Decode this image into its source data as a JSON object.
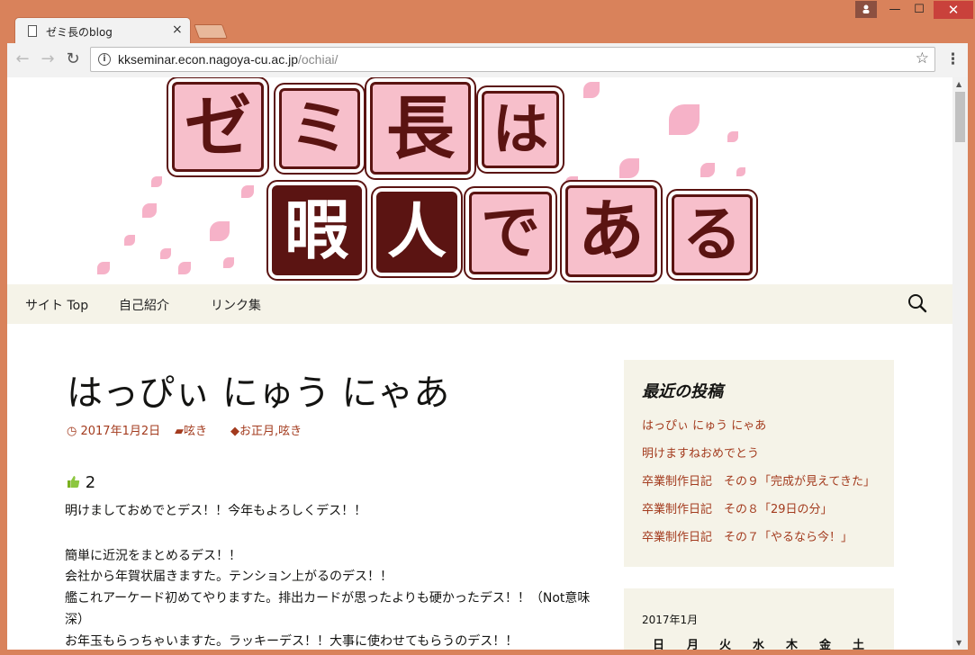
{
  "browser": {
    "tab_title": "ゼミ長のblog",
    "tab_close": "×",
    "url_host": "kkseminar.econ.nagoya-cu.ac.jp",
    "url_path": "/ochiai/",
    "back": "←",
    "forward": "→",
    "reload": "↻",
    "star": "☆",
    "menu": "⋮",
    "info": "i",
    "minimize": "—",
    "maximize": "☐",
    "close": "✕"
  },
  "banner": {
    "row1": [
      "ゼ",
      "ミ",
      "長",
      "は"
    ],
    "row2": [
      "暇",
      "人",
      "で",
      "あ",
      "る"
    ]
  },
  "nav": {
    "items": [
      "サイト Top",
      "自己紹介",
      "リンク集"
    ]
  },
  "post": {
    "title": "はっぴぃ にゅう にゃあ",
    "date": "2017年1月2日",
    "category": "呟き",
    "tags": "お正月,呟き",
    "likes": "2",
    "paragraphs": [
      "明けましておめでとデス！！今年もよろしくデス！！",
      "簡単に近況をまとめるデス！！",
      "会社から年賀状届きますた。テンション上がるのデス！！",
      "艦これアーケード初めてやりますた。排出カードが思ったよりも硬かったデス！！（Not意味",
      "深）",
      "お年玉もらっちゃいますた。ラッキーデス！！大事に使わせてもらうのデス！！"
    ]
  },
  "sidebar": {
    "recent_title": "最近の投稿",
    "recent_posts": [
      "はっぴぃ にゅう にゃあ",
      "明けますねおめでとう",
      "卒業制作日記　その９「完成が見えてきた」",
      "卒業制作日記　その８「29日の分」",
      "卒業制作日記　その７「やるなら今！」"
    ],
    "calendar_caption": "2017年1月",
    "calendar_days": [
      "日",
      "月",
      "火",
      "水",
      "木",
      "金",
      "土"
    ]
  },
  "colors": {
    "accent": "#a33b1e",
    "nav_bg": "#f5f3e8",
    "tile_pink": "#f7bfcb",
    "tile_dark": "#5b1412"
  }
}
